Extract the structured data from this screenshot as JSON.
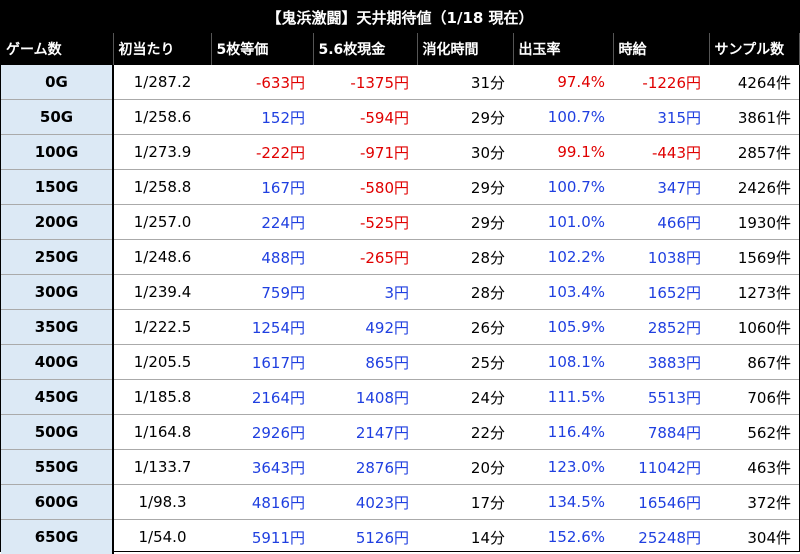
{
  "title": "【鬼浜激闘】天井期待値（1/18 現在）",
  "columns": [
    "ゲーム数",
    "初当たり",
    "5枚等価",
    "5.6枚現金",
    "消化時間",
    "出玉率",
    "時給",
    "サンプル数"
  ],
  "rows": [
    {
      "game": "0G",
      "hit": "1/287.2",
      "eq5": "-633円",
      "cash56": "-1375円",
      "time": "31分",
      "rate": "97.4%",
      "hourly": "-1226円",
      "samples": "4264件"
    },
    {
      "game": "50G",
      "hit": "1/258.6",
      "eq5": "152円",
      "cash56": "-594円",
      "time": "29分",
      "rate": "100.7%",
      "hourly": "315円",
      "samples": "3861件"
    },
    {
      "game": "100G",
      "hit": "1/273.9",
      "eq5": "-222円",
      "cash56": "-971円",
      "time": "30分",
      "rate": "99.1%",
      "hourly": "-443円",
      "samples": "2857件"
    },
    {
      "game": "150G",
      "hit": "1/258.8",
      "eq5": "167円",
      "cash56": "-580円",
      "time": "29分",
      "rate": "100.7%",
      "hourly": "347円",
      "samples": "2426件"
    },
    {
      "game": "200G",
      "hit": "1/257.0",
      "eq5": "224円",
      "cash56": "-525円",
      "time": "29分",
      "rate": "101.0%",
      "hourly": "466円",
      "samples": "1930件"
    },
    {
      "game": "250G",
      "hit": "1/248.6",
      "eq5": "488円",
      "cash56": "-265円",
      "time": "28分",
      "rate": "102.2%",
      "hourly": "1038円",
      "samples": "1569件"
    },
    {
      "game": "300G",
      "hit": "1/239.4",
      "eq5": "759円",
      "cash56": "3円",
      "time": "28分",
      "rate": "103.4%",
      "hourly": "1652円",
      "samples": "1273件"
    },
    {
      "game": "350G",
      "hit": "1/222.5",
      "eq5": "1254円",
      "cash56": "492円",
      "time": "26分",
      "rate": "105.9%",
      "hourly": "2852円",
      "samples": "1060件"
    },
    {
      "game": "400G",
      "hit": "1/205.5",
      "eq5": "1617円",
      "cash56": "865円",
      "time": "25分",
      "rate": "108.1%",
      "hourly": "3883円",
      "samples": "867件"
    },
    {
      "game": "450G",
      "hit": "1/185.8",
      "eq5": "2164円",
      "cash56": "1408円",
      "time": "24分",
      "rate": "111.5%",
      "hourly": "5513円",
      "samples": "706件"
    },
    {
      "game": "500G",
      "hit": "1/164.8",
      "eq5": "2926円",
      "cash56": "2147円",
      "time": "22分",
      "rate": "116.4%",
      "hourly": "7884円",
      "samples": "562件"
    },
    {
      "game": "550G",
      "hit": "1/133.7",
      "eq5": "3643円",
      "cash56": "2876円",
      "time": "20分",
      "rate": "123.0%",
      "hourly": "11042円",
      "samples": "463件"
    },
    {
      "game": "600G",
      "hit": "1/98.3",
      "eq5": "4816円",
      "cash56": "4023円",
      "time": "17分",
      "rate": "134.5%",
      "hourly": "16546円",
      "samples": "372件"
    },
    {
      "game": "650G",
      "hit": "1/54.0",
      "eq5": "5911円",
      "cash56": "5126円",
      "time": "14分",
      "rate": "152.6%",
      "hourly": "25248円",
      "samples": "304件"
    }
  ],
  "colors": {
    "positive": "#1f3fe0",
    "negative": "#e00000",
    "header_bg": "#000000",
    "game_col_bg": "#dce9f5"
  }
}
